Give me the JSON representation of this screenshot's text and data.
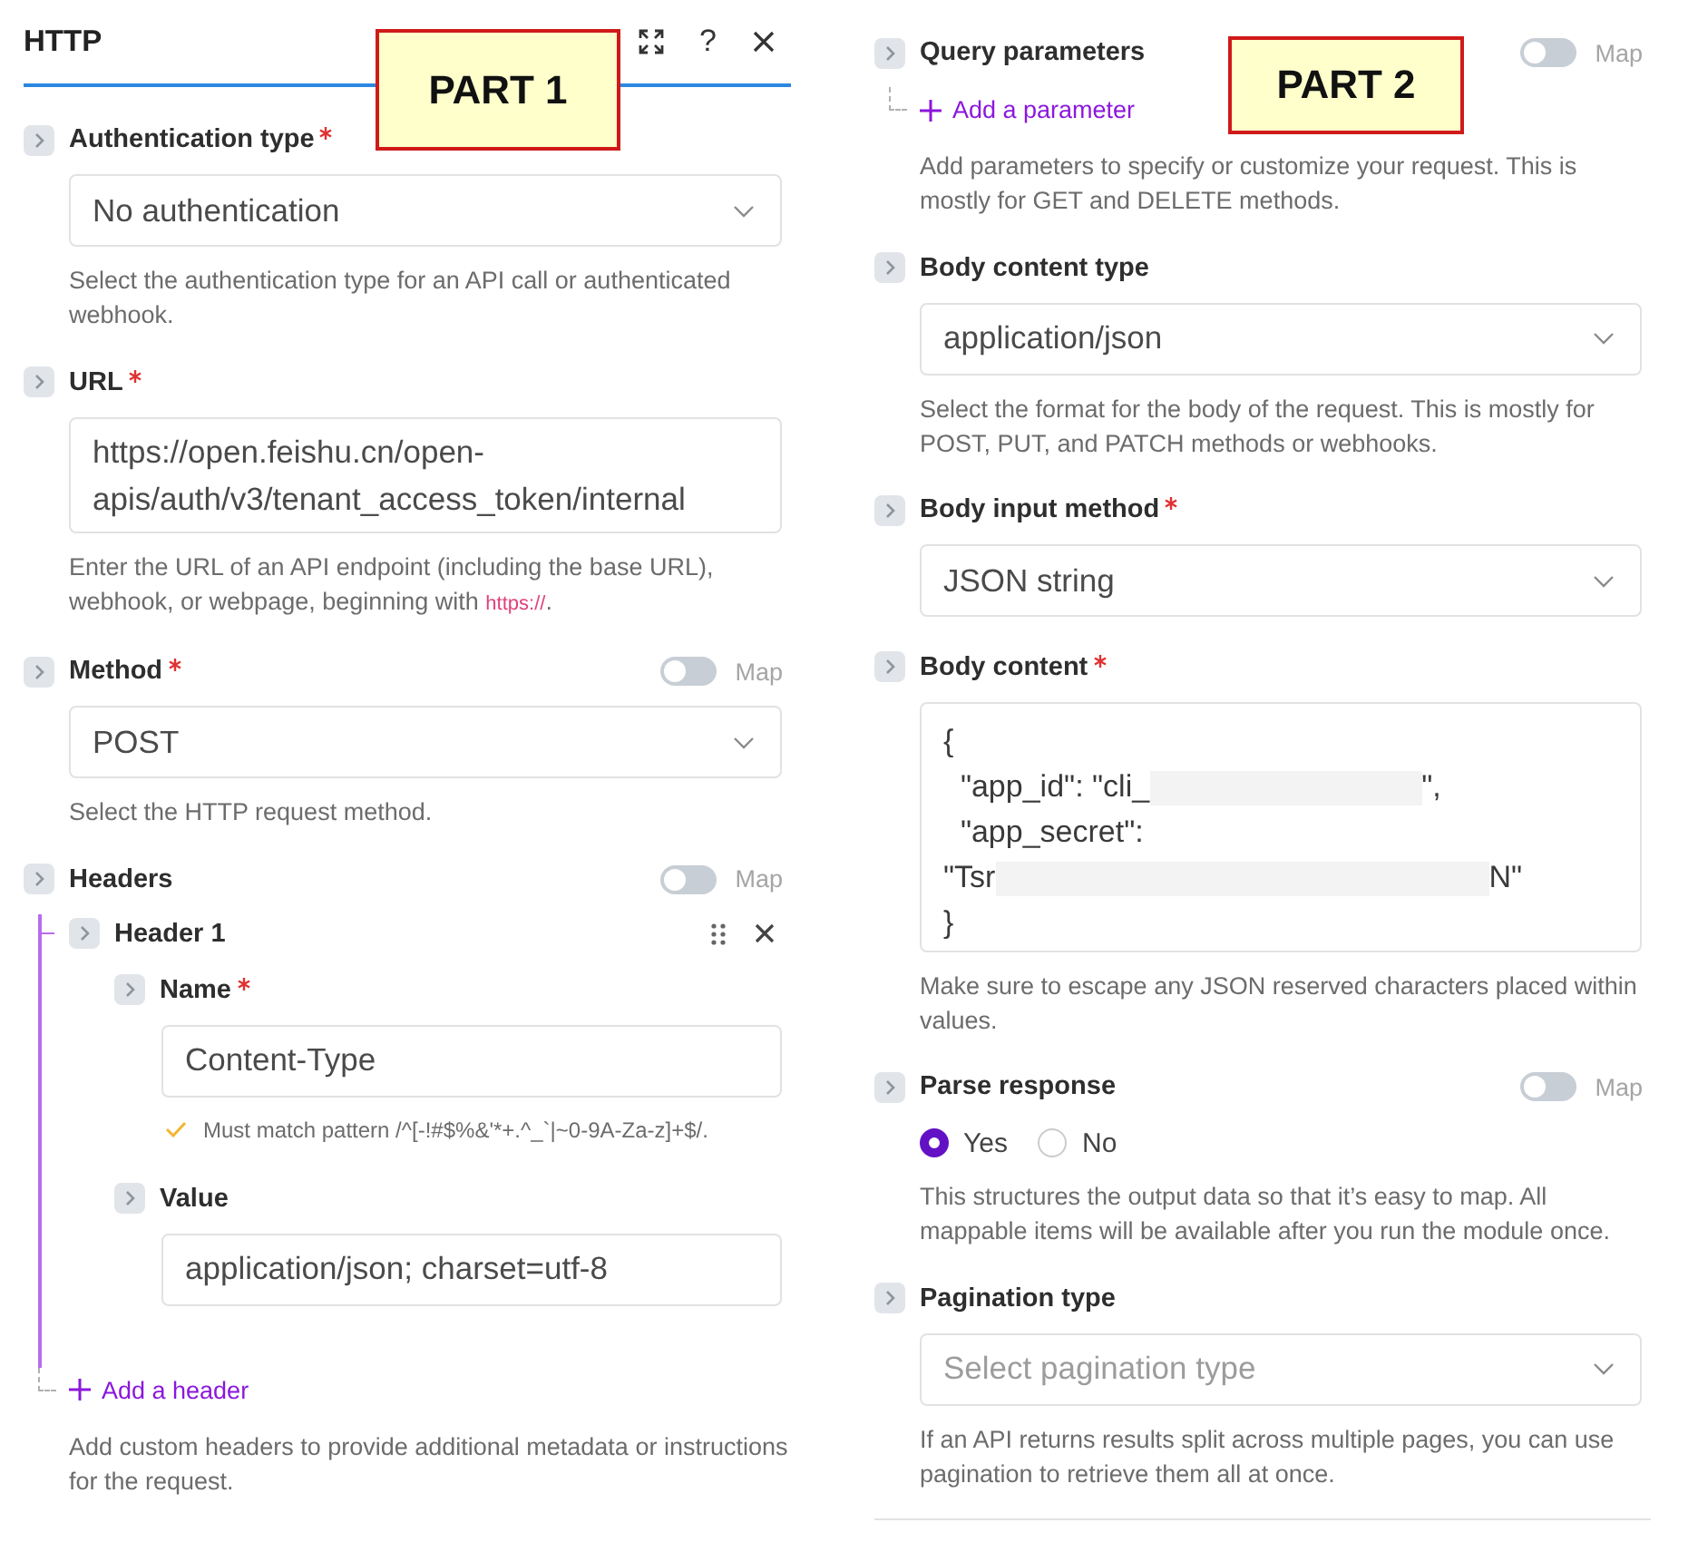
{
  "columns": [
    {
      "title": "HTTP",
      "actions": [
        {
          "kind": "expand"
        },
        {
          "kind": "help",
          "text": "?"
        },
        {
          "kind": "close"
        }
      ],
      "callout": "PART 1",
      "fields": [
        {
          "kind": "select",
          "label": "Authentication type",
          "required": true,
          "value": "No authentication",
          "help": [
            {
              "kind": "text",
              "text": "Select the authentication type for an API call or authenticated webhook."
            }
          ]
        },
        {
          "kind": "textarea",
          "label": "URL",
          "required": true,
          "value": "https://open.feishu.cn/open-apis/auth/v3/tenant_access_token/internal",
          "help": [
            {
              "kind": "text",
              "text": "Enter the URL of an API endpoint (including the base URL), webhook, or webpage, beginning with "
            },
            {
              "kind": "code",
              "text": "https://"
            },
            {
              "kind": "text",
              "text": "."
            }
          ]
        },
        {
          "kind": "select",
          "label": "Method",
          "required": true,
          "map": {
            "label": "Map",
            "on": false
          },
          "value": "POST",
          "help": [
            {
              "kind": "text",
              "text": "Select the HTTP request method."
            }
          ]
        },
        {
          "kind": "collection",
          "label": "Headers",
          "required": false,
          "map": {
            "label": "Map",
            "on": false
          },
          "items": [
            {
              "title": "Header 1",
              "fields": [
                {
                  "label": "Name",
                  "required": true,
                  "value": "Content-Type",
                  "validation": "Must match pattern /^[-!#$%&'*+.^_`|~0-9A-Za-z]+$/."
                },
                {
                  "label": "Value",
                  "required": false,
                  "value": "application/json; charset=utf-8"
                }
              ]
            }
          ],
          "add_label": "Add a header",
          "help": [
            {
              "kind": "text",
              "text": "Add custom headers to provide additional metadata or instructions for the request."
            }
          ]
        }
      ]
    },
    {
      "callout": "PART 2",
      "fields": [
        {
          "kind": "collection",
          "label": "Query parameters",
          "required": false,
          "map": {
            "label": "Map",
            "on": false
          },
          "add_label": "Add a parameter",
          "help": [
            {
              "kind": "text",
              "text": "Add parameters to specify or customize your request. This is mostly for GET and DELETE methods."
            }
          ]
        },
        {
          "kind": "select",
          "label": "Body content type",
          "required": false,
          "value": "application/json",
          "help": [
            {
              "kind": "text",
              "text": "Select the format for the body of the request. This is mostly for POST, PUT, and PATCH methods or webhooks."
            }
          ]
        },
        {
          "kind": "select",
          "label": "Body input method",
          "required": true,
          "value": "JSON string"
        },
        {
          "kind": "code",
          "label": "Body content",
          "required": true,
          "lines": [
            {
              "segments": [
                {
                  "kind": "text",
                  "text": "{"
                }
              ]
            },
            {
              "segments": [
                {
                  "kind": "text",
                  "text": "  \"app_id\": \"cli_"
                },
                {
                  "kind": "redacted"
                },
                {
                  "kind": "text",
                  "text": "\","
                }
              ]
            },
            {
              "segments": [
                {
                  "kind": "text",
                  "text": "  \"app_secret\":"
                }
              ]
            },
            {
              "segments": [
                {
                  "kind": "text",
                  "text": "\"Tsr"
                },
                {
                  "kind": "redacted"
                },
                {
                  "kind": "text",
                  "text": "N\""
                }
              ]
            },
            {
              "segments": [
                {
                  "kind": "text",
                  "text": "}"
                }
              ]
            }
          ],
          "help": [
            {
              "kind": "text",
              "text": "Make sure to escape any JSON reserved characters placed within values."
            }
          ]
        },
        {
          "kind": "radio",
          "label": "Parse response",
          "required": false,
          "map": {
            "label": "Map",
            "on": false
          },
          "options": [
            {
              "label": "Yes",
              "selected": true
            },
            {
              "label": "No",
              "selected": false
            }
          ],
          "help": [
            {
              "kind": "text",
              "text": "This structures the output data so that it’s easy to map. All mappable items will be available after you run the module once."
            }
          ]
        },
        {
          "kind": "select",
          "label": "Pagination type",
          "required": false,
          "placeholder": "Select pagination type",
          "help": [
            {
              "kind": "text",
              "text": "If an API returns results split across multiple pages, you can use pagination to retrieve them all at once."
            }
          ]
        }
      ]
    }
  ]
}
